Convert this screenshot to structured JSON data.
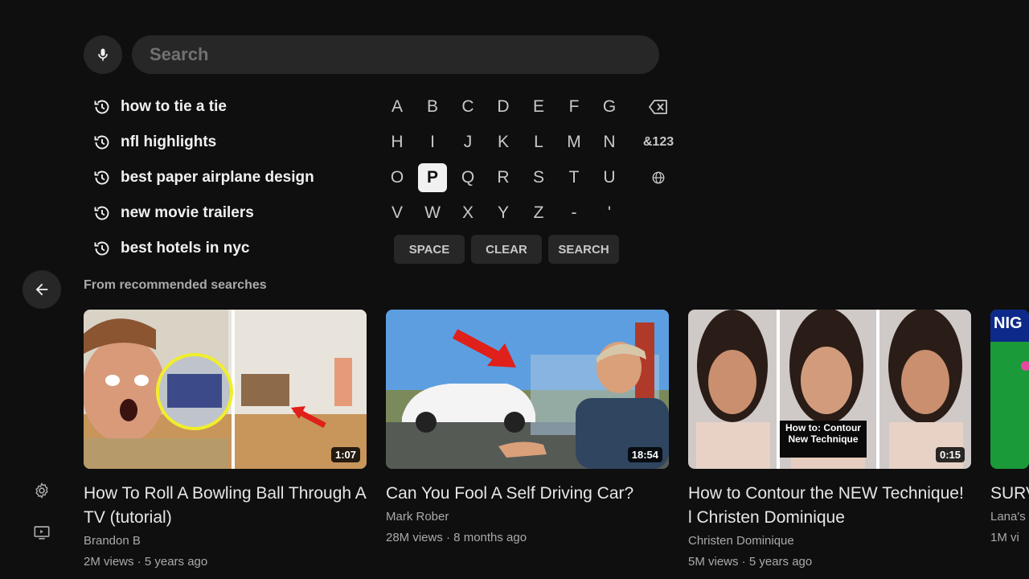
{
  "search": {
    "placeholder": "Search"
  },
  "history": [
    {
      "text": "how to tie a tie"
    },
    {
      "text": "nfl highlights"
    },
    {
      "text": "best paper airplane design"
    },
    {
      "text": "new movie trailers"
    },
    {
      "text": "best hotels in nyc"
    }
  ],
  "keyboard": {
    "rows": [
      [
        "A",
        "B",
        "C",
        "D",
        "E",
        "F",
        "G"
      ],
      [
        "H",
        "I",
        "J",
        "K",
        "L",
        "M",
        "N"
      ],
      [
        "O",
        "P",
        "Q",
        "R",
        "S",
        "T",
        "U"
      ],
      [
        "V",
        "W",
        "X",
        "Y",
        "Z",
        "-",
        "'"
      ]
    ],
    "selected_key": "P",
    "symbols_label": "&123",
    "space_label": "SPACE",
    "clear_label": "CLEAR",
    "search_label": "SEARCH"
  },
  "section_title": "From recommended searches",
  "videos": [
    {
      "title": "How To Roll A Bowling Ball Through A TV (tutorial)",
      "channel": "Brandon B",
      "meta": "2M views · 5 years ago",
      "duration": "1:07",
      "overlay": ""
    },
    {
      "title": "Can You Fool A Self Driving Car?",
      "channel": "Mark Rober",
      "meta": "28M views · 8 months ago",
      "duration": "18:54",
      "overlay": ""
    },
    {
      "title": "How to Contour the NEW Technique! l Christen Dominique",
      "channel": "Christen Dominique",
      "meta": "5M views · 5 years ago",
      "duration": "0:15",
      "overlay": "How to: Contour New Technique"
    },
    {
      "title": "SURV BEAR",
      "channel": "Lana's",
      "meta": "1M vi",
      "duration": "",
      "overlay": "NIG"
    }
  ],
  "colors": {
    "background": "#0f0f0f",
    "surface": "#272727",
    "text": "#f1f1f1",
    "muted": "#aaaaaa"
  },
  "icons": {
    "mic": "microphone-icon",
    "history": "history-clock-icon",
    "backspace": "backspace-icon",
    "language": "globe-icon",
    "back": "arrow-left-icon",
    "settings": "gear-icon",
    "tv": "tv-icon"
  }
}
